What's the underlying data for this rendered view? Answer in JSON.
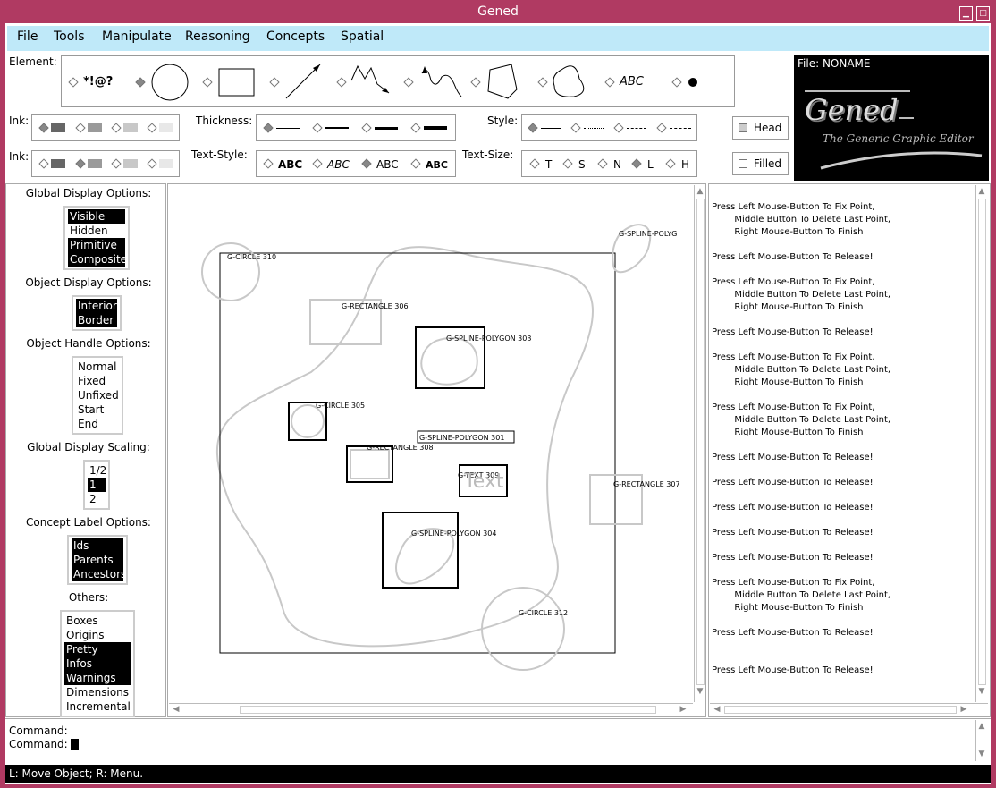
{
  "window": {
    "title": "Gened"
  },
  "menubar": {
    "items": [
      "File",
      "Tools",
      "Manipulate",
      "Reasoning",
      "Concepts",
      "Spatial"
    ]
  },
  "element": {
    "label": "Element:",
    "symbol_text": "*!@?",
    "text_sample": "ABC"
  },
  "ink1": {
    "label": "Ink:",
    "colors": [
      "#666666",
      "#9a9a9a",
      "#c8c8c8",
      "#e8e8e8"
    ]
  },
  "thickness": {
    "label": "Thickness:"
  },
  "style": {
    "label": "Style:"
  },
  "head": {
    "label": "Head"
  },
  "ink2": {
    "label": "Ink:",
    "colors": [
      "#666666",
      "#9a9a9a",
      "#c8c8c8",
      "#e8e8e8"
    ]
  },
  "text_style": {
    "label": "Text-Style:",
    "samples": [
      "ABC",
      "ABC",
      "ABC",
      "ABC"
    ]
  },
  "text_size": {
    "label": "Text-Size:",
    "options": [
      "T",
      "S",
      "N",
      "L",
      "H"
    ]
  },
  "filled": {
    "label": "Filled"
  },
  "logo": {
    "file_label": "File: NONAME",
    "name": "Gened",
    "subtitle": "The Generic Graphic Editor"
  },
  "sidebar": {
    "global_display": {
      "title": "Global Display Options:",
      "items": [
        "Visible",
        "Hidden",
        "Primitive",
        "Composite"
      ]
    },
    "object_display": {
      "title": "Object Display Options:",
      "items": [
        "Interior",
        "Border"
      ]
    },
    "object_handle": {
      "title": "Object Handle Options:",
      "items": [
        "Normal",
        "Fixed",
        "Unfixed",
        "Start",
        "End"
      ]
    },
    "scaling": {
      "title": "Global Display Scaling:",
      "items": [
        "1/2",
        "1",
        "2"
      ]
    },
    "concept_label": {
      "title": "Concept Label Options:",
      "items": [
        "Ids",
        "Parents",
        "Ancestors"
      ]
    },
    "others": {
      "title": "Others:",
      "items": [
        "Boxes",
        "Origins",
        "Pretty",
        "Infos",
        "Warnings",
        "Dimensions",
        "Incremental"
      ]
    }
  },
  "canvas": {
    "labels": {
      "c310": "G-CIRCLE 310",
      "sp_polyg": "G-SPLINE-POLYG",
      "r306": "G-RECTANGLE 306",
      "sp303": "G-SPLINE-POLYGON 303",
      "c305": "G-CIRCLE 305",
      "sp301": "G-SPLINE-POLYGON 301",
      "r308": "G-RECTANGLE 308",
      "t309": "G-TEXT 309",
      "text_obj": "Text",
      "r307": "G-RECTANGLE 307",
      "sp304": "G-SPLINE-POLYGON 304",
      "c312": "G-CIRCLE 312"
    }
  },
  "messages": {
    "fix": "Press Left Mouse-Button To Fix Point,\n        Middle Button To Delete Last Point,\n        Right Mouse-Button To Finish!",
    "release": "Press Left Mouse-Button To Release!"
  },
  "command": {
    "line1": "Command:",
    "line2": "Command:"
  },
  "status": {
    "text": "L: Move Object; R: Menu."
  }
}
